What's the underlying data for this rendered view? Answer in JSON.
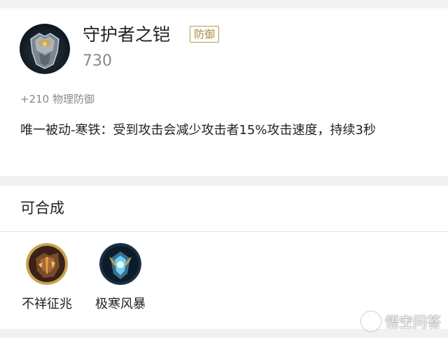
{
  "item": {
    "name": "守护者之铠",
    "tag": "防御",
    "price": "730",
    "stat": "+210 物理防御",
    "description": "唯一被动-寒铁：受到攻击会减少攻击者15%攻击速度，持续3秒"
  },
  "synthesis": {
    "title": "可合成",
    "items": [
      {
        "label": "不祥征兆",
        "icon": "omen-armor-icon"
      },
      {
        "label": "极寒风暴",
        "icon": "frost-storm-icon"
      }
    ]
  },
  "watermark": {
    "text": "悟空问答"
  },
  "colors": {
    "tag_border": "#b49a5a",
    "tag_text": "#a8873d",
    "muted_text": "#888888",
    "background": "#f1f1f1"
  }
}
